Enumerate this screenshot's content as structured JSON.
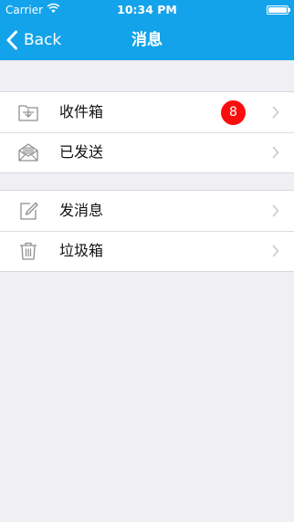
{
  "status_bar": {
    "carrier": "Carrier",
    "time": "10:34 PM"
  },
  "nav": {
    "back_label": "Back",
    "title": "消息"
  },
  "colors": {
    "nav_background": "#13a3ea",
    "badge": "#fc0d0d",
    "page_background": "#efeff4"
  },
  "menu_groups": [
    {
      "items": [
        {
          "icon": "inbox-icon",
          "label": "收件箱",
          "badge": "8"
        },
        {
          "icon": "sent-mail-icon",
          "label": "已发送"
        }
      ]
    },
    {
      "items": [
        {
          "icon": "compose-icon",
          "label": "发消息"
        },
        {
          "icon": "trash-icon",
          "label": "垃圾箱"
        }
      ]
    }
  ]
}
